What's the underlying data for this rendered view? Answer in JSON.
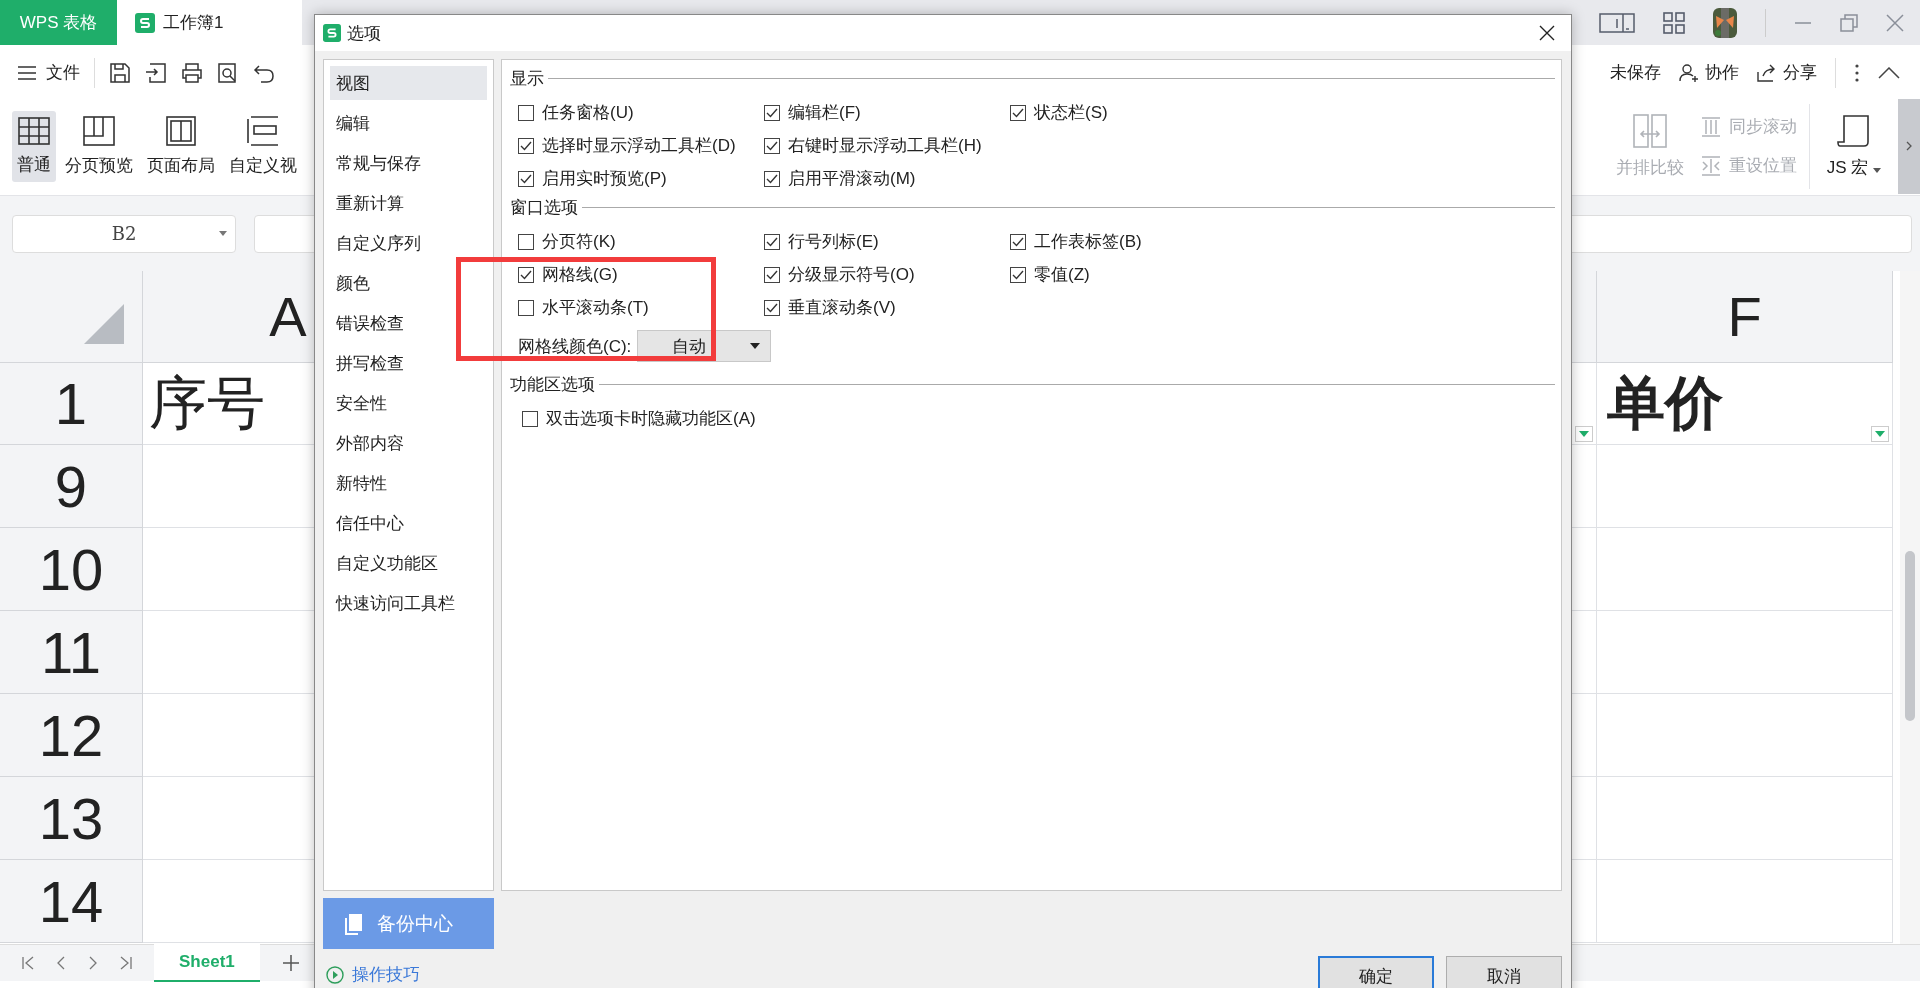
{
  "app_tabs": [
    {
      "kind": "brand",
      "label": "WPS 表格",
      "selected": false
    },
    {
      "kind": "document",
      "label": "工作簿1",
      "selected": true
    }
  ],
  "menu": {
    "label": "文件"
  },
  "ribbon_left": [
    {
      "label": "普通",
      "kind": "grid",
      "selected": true
    },
    {
      "label": "分页预览",
      "kind": "pagebreak",
      "selected": false
    },
    {
      "label": "页面布局",
      "kind": "layout",
      "selected": false
    },
    {
      "label": "自定义视",
      "kind": "custom",
      "selected": false
    }
  ],
  "quick_actions": [
    {
      "label": "未保存",
      "kind": "cloud"
    },
    {
      "label": "协作",
      "kind": "person"
    },
    {
      "label": "分享",
      "kind": "share"
    }
  ],
  "ribbon_right": [
    {
      "label": "并排比较",
      "kind": "compare",
      "disabled": true
    },
    {
      "label": "同步滚动",
      "kind": "sync",
      "disabled": true
    },
    {
      "label": "重设位置",
      "kind": "reset",
      "disabled": true
    },
    {
      "label": "JS 宏",
      "kind": "js",
      "disabled": false
    }
  ],
  "name_box": {
    "value": "B2"
  },
  "sheet": {
    "column_headers": [
      {
        "label": "A"
      },
      {
        "label": "F"
      }
    ],
    "rows": [
      {
        "number": "1",
        "kind": "header",
        "column_a": "序号",
        "column_f": "单价"
      },
      {
        "number": "9",
        "kind": "data"
      },
      {
        "number": "10",
        "kind": "data"
      },
      {
        "number": "11",
        "kind": "data"
      },
      {
        "number": "12",
        "kind": "data"
      },
      {
        "number": "13",
        "kind": "data"
      },
      {
        "number": "14",
        "kind": "data"
      }
    ]
  },
  "sheet_tabs": [
    {
      "label": "Sheet1",
      "selected": true
    }
  ],
  "dialog": {
    "title": "选项",
    "nav": [
      {
        "label": "视图",
        "selected": true
      },
      {
        "label": "编辑",
        "selected": false
      },
      {
        "label": "常规与保存",
        "selected": false
      },
      {
        "label": "重新计算",
        "selected": false
      },
      {
        "label": "自定义序列",
        "selected": false
      },
      {
        "label": "颜色",
        "selected": false
      },
      {
        "label": "错误检查",
        "selected": false
      },
      {
        "label": "拼写检查",
        "selected": false
      },
      {
        "label": "安全性",
        "selected": false
      },
      {
        "label": "外部内容",
        "selected": false
      },
      {
        "label": "新特性",
        "selected": false
      },
      {
        "label": "信任中心",
        "selected": false
      },
      {
        "label": "自定义功能区",
        "selected": false
      },
      {
        "label": "快速访问工具栏",
        "selected": false
      }
    ],
    "sections": [
      {
        "title": "显示",
        "rows": [
          [
            {
              "label": "任务窗格(U)",
              "checked": false
            },
            {
              "label": "编辑栏(F)",
              "checked": true
            },
            {
              "label": "状态栏(S)",
              "checked": true
            }
          ],
          [
            {
              "label": "选择时显示浮动工具栏(D)",
              "checked": true
            },
            {
              "label": "右键时显示浮动工具栏(H)",
              "checked": true
            }
          ],
          [
            {
              "label": "启用实时预览(P)",
              "checked": true
            },
            {
              "label": "启用平滑滚动(M)",
              "checked": true
            }
          ]
        ]
      },
      {
        "title": "窗口选项",
        "rows": [
          [
            {
              "label": "分页符(K)",
              "checked": false
            },
            {
              "label": "行号列标(E)",
              "checked": true
            },
            {
              "label": "工作表标签(B)",
              "checked": true
            }
          ],
          [
            {
              "label": "网格线(G)",
              "checked": true
            },
            {
              "label": "分级显示符号(O)",
              "checked": true
            },
            {
              "label": "零值(Z)",
              "checked": true
            }
          ],
          [
            {
              "label": "水平滚动条(T)",
              "checked": false
            },
            {
              "label": "垂直滚动条(V)",
              "checked": true
            }
          ]
        ],
        "select": {
          "label": "网格线颜色(C):",
          "value": "自动"
        }
      },
      {
        "title": "功能区选项",
        "rows": [
          [
            {
              "label": "双击选项卡时隐藏功能区(A)",
              "checked": false
            }
          ]
        ]
      }
    ],
    "backup_button": "备份中心",
    "tips_link": "操作技巧",
    "buttons": [
      {
        "label": "确定",
        "kind": "primary"
      },
      {
        "label": "取消",
        "kind": "secondary"
      }
    ],
    "annotation": {
      "kind": "frame"
    }
  }
}
